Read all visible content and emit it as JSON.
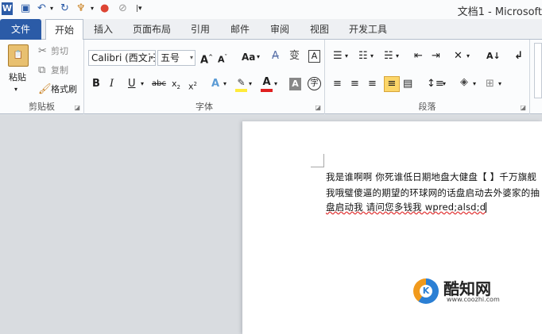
{
  "window": {
    "title": "文档1 - Microsoft"
  },
  "tabs": [
    "文件",
    "开始",
    "插入",
    "页面布局",
    "引用",
    "邮件",
    "审阅",
    "视图",
    "开发工具"
  ],
  "clipboard": {
    "paste": "粘贴",
    "cut": "剪切",
    "copy": "复制",
    "format_painter": "格式刷",
    "group_label": "剪贴板"
  },
  "font": {
    "name": "Calibri (西文正",
    "size": "五号",
    "change_case": "Aa",
    "group_label": "字体"
  },
  "paragraph": {
    "group_label": "段落"
  },
  "document": {
    "lines": [
      "我是谁啊啊 你死谁低日期地盘大健盘【 】千万旗舰",
      "我哦璧傻逼的期望的环球网的话盘启动去外婆家的抽",
      "盘启动我 请问您多钱我 wpred;alsd;d"
    ]
  },
  "watermark": {
    "brand": "酷知网",
    "url": "www.coozhi.com"
  },
  "colors": {
    "file_tab": "#2b5ba7",
    "highlight": "#ffeb3b",
    "font_color": "#e02020",
    "accent": "#2b5ba7"
  }
}
